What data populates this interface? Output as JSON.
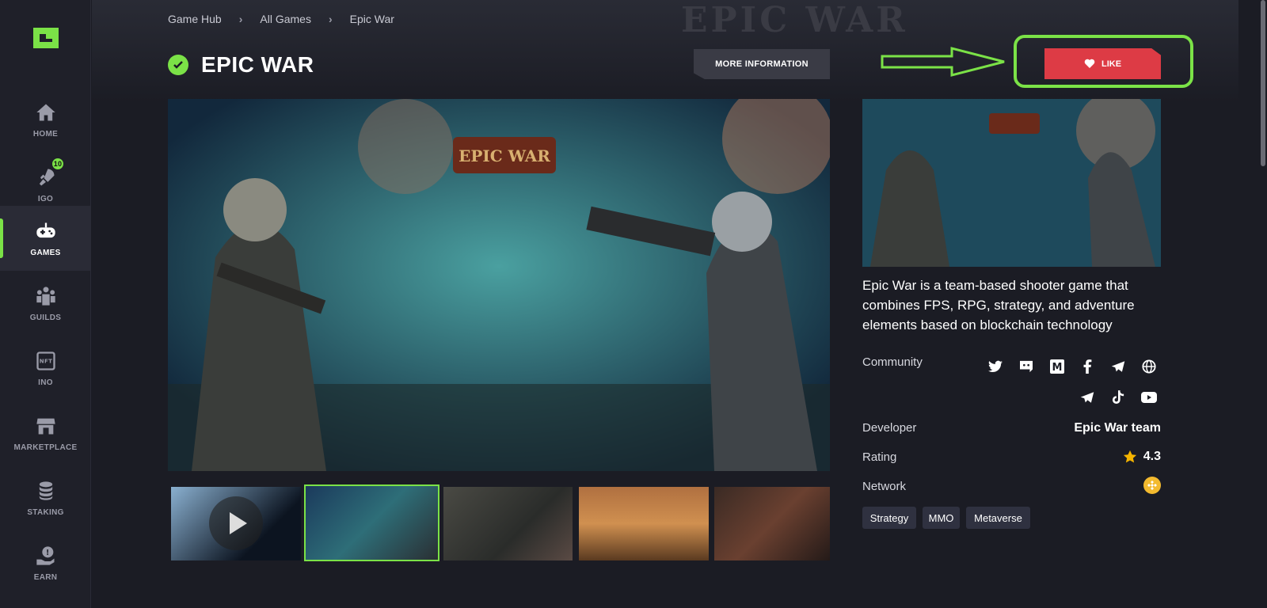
{
  "sidebar": {
    "items": [
      {
        "label": "HOME",
        "icon": "home-icon"
      },
      {
        "label": "IGO",
        "icon": "rocket-icon",
        "badge": "10"
      },
      {
        "label": "GAMES",
        "icon": "gamepad-icon",
        "active": true
      },
      {
        "label": "GUILDS",
        "icon": "guild-icon"
      },
      {
        "label": "INO",
        "icon": "nft-icon"
      },
      {
        "label": "MARKETPLACE",
        "icon": "store-icon"
      },
      {
        "label": "STAKING",
        "icon": "coins-icon"
      },
      {
        "label": "EARN",
        "icon": "earn-icon"
      }
    ]
  },
  "breadcrumb": [
    "Game Hub",
    "All Games",
    "Epic War"
  ],
  "header": {
    "title": "EPIC WAR",
    "more_info_label": "MORE INFORMATION",
    "like_label": "LIKE",
    "hero_watermark": "EPIC WAR"
  },
  "game_logo_text": "EPIC WAR",
  "description": "Epic War is a team-based shooter game that combines FPS, RPG, strategy, and adventure elements based on blockchain technology",
  "info": {
    "community_label": "Community",
    "developer_label": "Developer",
    "developer_value": "Epic War team",
    "rating_label": "Rating",
    "rating_value": "4.3",
    "network_label": "Network"
  },
  "social_icons": [
    "twitter-icon",
    "discord-icon",
    "medium-icon",
    "facebook-icon",
    "telegram-icon",
    "website-icon",
    "telegram-icon",
    "tiktok-icon",
    "youtube-icon"
  ],
  "tags": [
    "Strategy",
    "MMO",
    "Metaverse"
  ],
  "colors": {
    "accent": "#7be247",
    "like": "#dd3b45",
    "star": "#f5b400",
    "network": "#f3ba2f"
  }
}
